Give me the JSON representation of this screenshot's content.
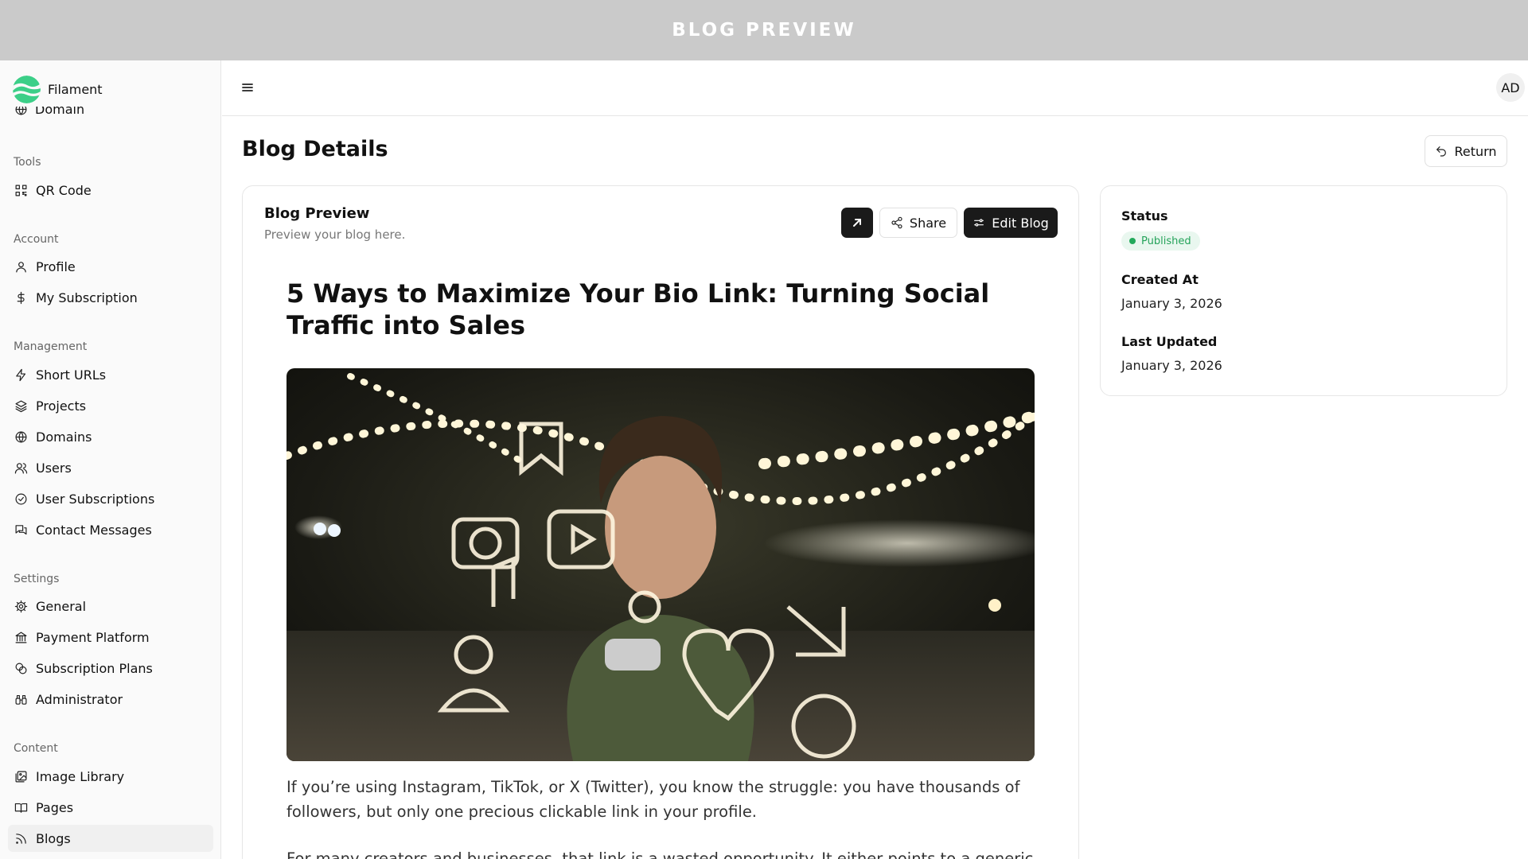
{
  "topbar": {
    "title": "BLOG PREVIEW"
  },
  "brand": {
    "name": "Filament"
  },
  "sidebar": {
    "cut_item": "Domain",
    "groups": [
      {
        "title": "Tools",
        "items": [
          {
            "label": "QR Code",
            "icon": "qr-code-icon"
          }
        ]
      },
      {
        "title": "Account",
        "items": [
          {
            "label": "Profile",
            "icon": "user-icon"
          },
          {
            "label": "My Subscription",
            "icon": "dollar-icon"
          }
        ]
      },
      {
        "title": "Management",
        "items": [
          {
            "label": "Short URLs",
            "icon": "bolt-icon"
          },
          {
            "label": "Projects",
            "icon": "layers-icon"
          },
          {
            "label": "Domains",
            "icon": "globe-icon"
          },
          {
            "label": "Users",
            "icon": "users-icon"
          },
          {
            "label": "User Subscriptions",
            "icon": "check-circle-icon"
          },
          {
            "label": "Contact Messages",
            "icon": "messages-icon"
          }
        ]
      },
      {
        "title": "Settings",
        "items": [
          {
            "label": "General",
            "icon": "gear-icon"
          },
          {
            "label": "Payment Platform",
            "icon": "bank-icon"
          },
          {
            "label": "Subscription Plans",
            "icon": "coins-icon"
          },
          {
            "label": "Administrator",
            "icon": "binoculars-icon"
          }
        ]
      },
      {
        "title": "Content",
        "items": [
          {
            "label": "Image Library",
            "icon": "images-icon"
          },
          {
            "label": "Pages",
            "icon": "book-icon"
          },
          {
            "label": "Blogs",
            "icon": "rss-icon",
            "active": true
          }
        ]
      }
    ]
  },
  "header": {
    "avatar_initials": "AD"
  },
  "page": {
    "title": "Blog Details",
    "return_label": "Return"
  },
  "preview": {
    "title": "Blog Preview",
    "subtitle": "Preview your blog here.",
    "share_label": "Share",
    "edit_label": "Edit Blog"
  },
  "article": {
    "title": "5 Ways to Maximize Your Bio Link: Turning Social Traffic into Sales",
    "paragraph_1": "If you’re using Instagram, TikTok, or X (Twitter), you know the struggle: you have thousands of followers, but only one precious clickable link in your profile.",
    "paragraph_2": "For many creators and businesses, that link is a wasted opportunity. It either points to a generic"
  },
  "meta": {
    "status_label": "Status",
    "status_value": "Published",
    "status_color": "#22a95b",
    "created_label": "Created At",
    "created_value": "January 3, 2026",
    "updated_label": "Last Updated",
    "updated_value": "January 3, 2026"
  }
}
